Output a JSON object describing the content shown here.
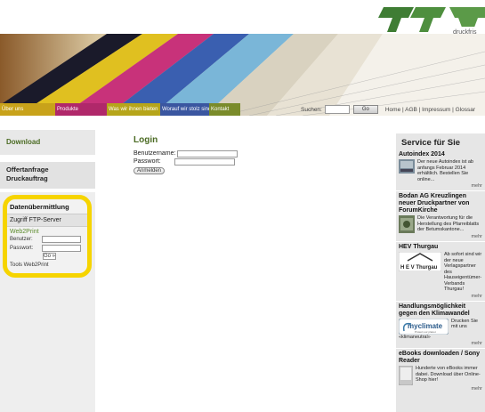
{
  "header": {
    "logo_sub": "druckfris",
    "nav": [
      {
        "label": "Über uns",
        "color": "#c8a21a"
      },
      {
        "label": "Produkte",
        "color": "#b0286a"
      },
      {
        "label": "Was wir ihnen bieten",
        "color": "#b6a51a"
      },
      {
        "label": "Worauf wir stolz sind",
        "color": "#3a56a0"
      },
      {
        "label": "Kontakt",
        "color": "#7a8b2a"
      }
    ],
    "search_label": "Suchen:",
    "search_value": "",
    "go_label": "Go",
    "toplinks": "Home | AGB | Impressum | Glossar"
  },
  "sidebar": {
    "download": "Download",
    "offer_line1": "Offertanfrage",
    "offer_line2": "Druckauftrag",
    "upload_title": "Datenübermittlung",
    "ftp_label": "Zugriff FTP-Server",
    "web2print_title": "Web2Print",
    "user_label": "Benutzer:",
    "pass_label": "Passwort:",
    "go_label": "Go »",
    "tools_label": "Tools Web2Print"
  },
  "login": {
    "title": "Login",
    "user_label": "Benutzername:",
    "pass_label": "Passwort:",
    "button": "Anmelden"
  },
  "service": {
    "title": "Service für Sie",
    "items": [
      {
        "title": "Autoindex 2014",
        "text": "Der neue Autoindex ist ab anfangs Februar 2014 erhältlich. Bestellen Sie online...",
        "more": "mehr"
      },
      {
        "title": "Bodan AG Kreuzlingen neuer Druckpartner von ForumKirche",
        "text": "Die Verantwortung für die Herstellung des Pfarreiblatts der Betumskantone...",
        "more": "mehr"
      },
      {
        "title": "HEV Thurgau",
        "text": "Ab sofort sind wir der neue Verlagspartner des Hauseigentümer-Verbands Thurgau!",
        "logo": "H E V Thurgau",
        "more": "mehr"
      },
      {
        "title": "Handlungsmöglichkeit gegen den Klimawandel",
        "text": "Drucken Sie mit uns",
        "logo": "myclimate",
        "logo_sub": "Protect our planet",
        "extra": "«klimaneutral»",
        "more": "mehr"
      },
      {
        "title": "eBooks downloaden / Sony Reader",
        "text": "Hunderte von eBooks immer dabei. Download über Online-Shop hier!",
        "more": "mehr"
      }
    ]
  },
  "colors": {
    "accent_green": "#4b6b23",
    "highlight": "#f6d400",
    "logo_green": "#5b8a3a"
  }
}
